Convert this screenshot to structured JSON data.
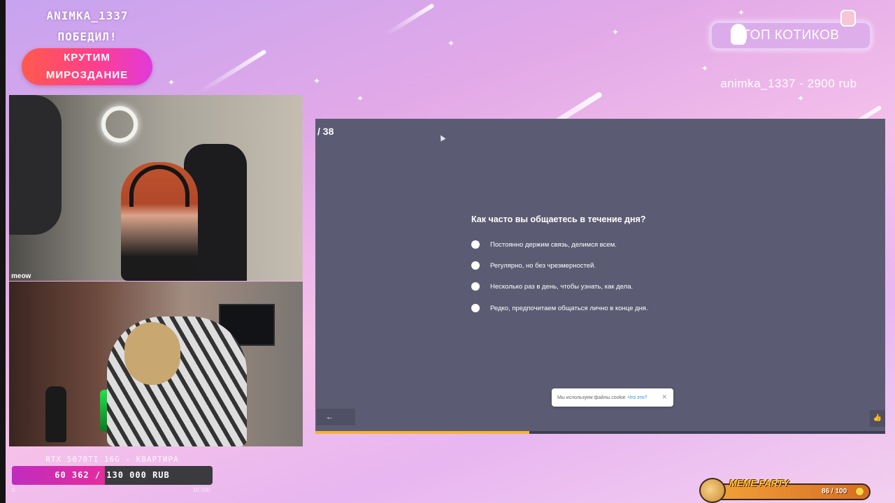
{
  "overlay": {
    "winner_line1": "ANIMKA_1337",
    "winner_line2": "ПОБЕДИЛ!",
    "spin_line1": "КРУТИМ",
    "spin_line2": "МИРОЗДАНИЕ"
  },
  "cams": {
    "cam1_label": "meow"
  },
  "goal": {
    "title": "RTX 5070TI 16G - КВАРТИРА",
    "current": "60 362",
    "separator": "/",
    "target": "130 000 RUB",
    "progress_fraction": 0.464,
    "min_label": "0",
    "max_label": "10 000"
  },
  "top_cats": {
    "title": "ТОП КОТИКОВ",
    "donor_line": "animka_1337 - 2900 rub"
  },
  "quiz": {
    "counter": "/ 38",
    "question": "Как часто вы общаетесь в течение дня?",
    "options": [
      "Постоянно держим связь, делимся всем.",
      "Регулярно, но без чрезмерностей.",
      "Несколько раз в день, чтобы узнать, как дела.",
      "Редко, предпочитаем общаться лично в конце дня."
    ],
    "cookie_text": "Мы используем файлы cookie",
    "cookie_link": "Что это?",
    "cookie_close": "✕",
    "back_label": "←",
    "like_icon": "👍",
    "progress_fraction": 0.375
  },
  "meme_party": {
    "title": "MEME PARTY",
    "count": "86 / 100"
  },
  "colors": {
    "quiz_bg": "#5b5c73",
    "quiz_progress": "#f5b336",
    "goal_fill": "#e52c9d"
  }
}
